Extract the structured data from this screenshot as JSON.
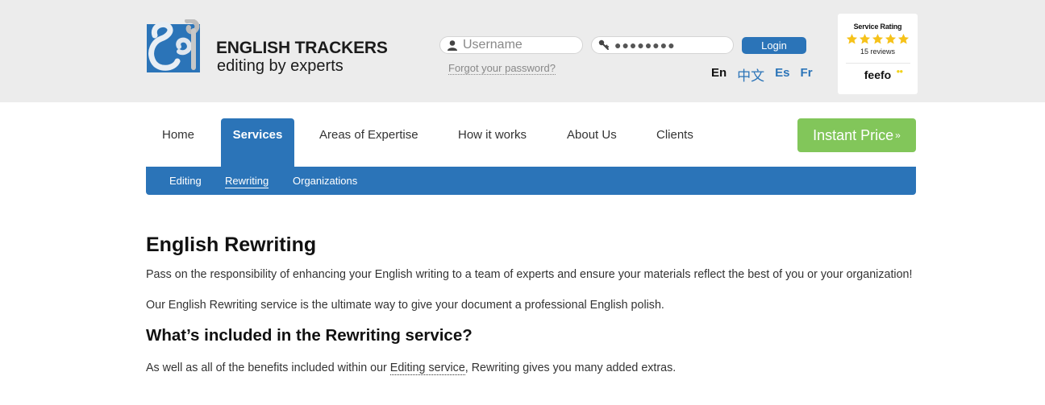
{
  "brand": {
    "title": "ENGLISH TRACKERS",
    "tagline": "editing by experts",
    "colors": {
      "primary": "#2b74b8",
      "accent_green": "#82c65a",
      "header_bg": "#ececec"
    }
  },
  "login": {
    "username_placeholder": "Username",
    "password_value": "●●●●●●●●",
    "login_label": "Login",
    "forgot_label": "Forgot your password?",
    "icons": {
      "username": "user-icon",
      "password": "key-icon"
    }
  },
  "languages": [
    {
      "label": "En",
      "active": true
    },
    {
      "label": "中文",
      "active": false
    },
    {
      "label": "Es",
      "active": false
    },
    {
      "label": "Fr",
      "active": false
    }
  ],
  "rating": {
    "title": "Service Rating",
    "stars": 5,
    "max_stars": 5,
    "reviews": "15 reviews",
    "provider": "feefo"
  },
  "nav": {
    "items": [
      {
        "label": "Home",
        "active": false
      },
      {
        "label": "Services",
        "active": true
      },
      {
        "label": "Areas of Expertise",
        "active": false
      },
      {
        "label": "How it works",
        "active": false
      },
      {
        "label": "About Us",
        "active": false
      },
      {
        "label": "Clients",
        "active": false
      }
    ],
    "cta_label": "Instant Price",
    "cta_icon": "double-chevron-down-icon"
  },
  "subnav": {
    "items": [
      {
        "label": "Editing",
        "active": false
      },
      {
        "label": "Rewriting",
        "active": true
      },
      {
        "label": "Organizations",
        "active": false
      }
    ]
  },
  "content": {
    "title": "English Rewriting",
    "intro": "Pass on the responsibility of enhancing your English writing to a team of experts and ensure your materials reflect the best of you or your organization!",
    "intro2": "Our English Rewriting service is the ultimate way to give your document a professional English polish.",
    "section_title": "What’s included in the Rewriting service?",
    "section_text_before": "As well as all of the benefits included within our ",
    "section_link": "Editing service",
    "section_text_after": ", Rewriting gives you many added extras."
  }
}
